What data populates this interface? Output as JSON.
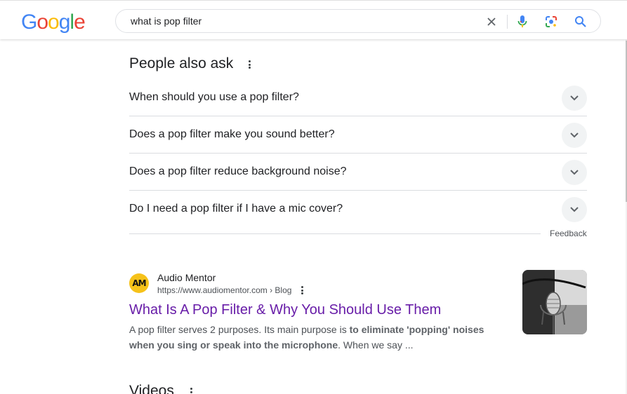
{
  "header": {
    "logo_letters": [
      {
        "char": "G",
        "color": "#4285F4"
      },
      {
        "char": "o",
        "color": "#EA4335"
      },
      {
        "char": "o",
        "color": "#FBBC05"
      },
      {
        "char": "g",
        "color": "#4285F4"
      },
      {
        "char": "l",
        "color": "#34A853"
      },
      {
        "char": "e",
        "color": "#EA4335"
      }
    ],
    "search": {
      "query": "what is pop filter",
      "icons": [
        "clear-icon",
        "microphone-icon",
        "lens-icon",
        "search-icon"
      ]
    }
  },
  "paa": {
    "heading": "People also ask",
    "questions": [
      "When should you use a pop filter?",
      "Does a pop filter make you sound better?",
      "Does a pop filter reduce background noise?",
      "Do I need a pop filter if I have a mic cover?"
    ],
    "feedback_label": "Feedback"
  },
  "result": {
    "favicon_text": "AM",
    "site_name": "Audio Mentor",
    "url": "https://www.audiomentor.com › Blog",
    "title": "What Is A Pop Filter & Why You Should Use Them",
    "snippet": {
      "part1": "A pop filter serves 2 purposes. Its main purpose is ",
      "bold": "to eliminate 'popping' noises when you sing or speak into the microphone",
      "part2": ". When we say ..."
    }
  },
  "videos": {
    "heading": "Videos"
  },
  "colors": {
    "visited_link": "#681da8",
    "chevron_bg": "#f1f3f4",
    "favicon_bg": "#f6c21a"
  }
}
